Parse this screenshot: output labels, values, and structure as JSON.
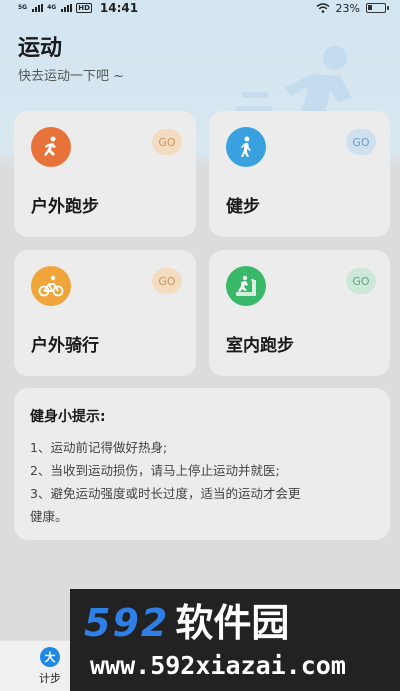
{
  "status_bar": {
    "net1": "5G",
    "net2": "4G",
    "hd": "HD",
    "time": "14:41",
    "battery": "23%"
  },
  "header": {
    "title": "运动",
    "subtitle": "快去运动一下吧 ~"
  },
  "cards": [
    {
      "label": "户外跑步",
      "go": "GO",
      "icon": "running-icon",
      "color": "#e8733a",
      "go_bg": "#f3dcc0",
      "go_color": "#c79560"
    },
    {
      "label": "健步",
      "go": "GO",
      "icon": "walking-icon",
      "color": "#3aa1e0",
      "go_bg": "#cfe1ee",
      "go_color": "#6a9ec2"
    },
    {
      "label": "户外骑行",
      "go": "GO",
      "icon": "cycling-icon",
      "color": "#f0a53a",
      "go_bg": "#f3dcc0",
      "go_color": "#c79560"
    },
    {
      "label": "室内跑步",
      "go": "GO",
      "icon": "treadmill-icon",
      "color": "#3ab86a",
      "go_bg": "#cde8d8",
      "go_color": "#5fa27c"
    }
  ],
  "tips": {
    "title": "健身小提示:",
    "lines": [
      "1、运动前记得做好热身;",
      "2、当收到运动损伤，请马上停止运动并就医;",
      "3、避免运动强度或时长过度，适当的运动才会更",
      "健康。"
    ]
  },
  "tab_bar": {
    "items": [
      {
        "label": "计步",
        "icon": "step-icon",
        "icon_glyph": "大"
      }
    ]
  },
  "watermark": {
    "number": "592",
    "name": "软件园",
    "url": "www.592xiazai.com"
  }
}
